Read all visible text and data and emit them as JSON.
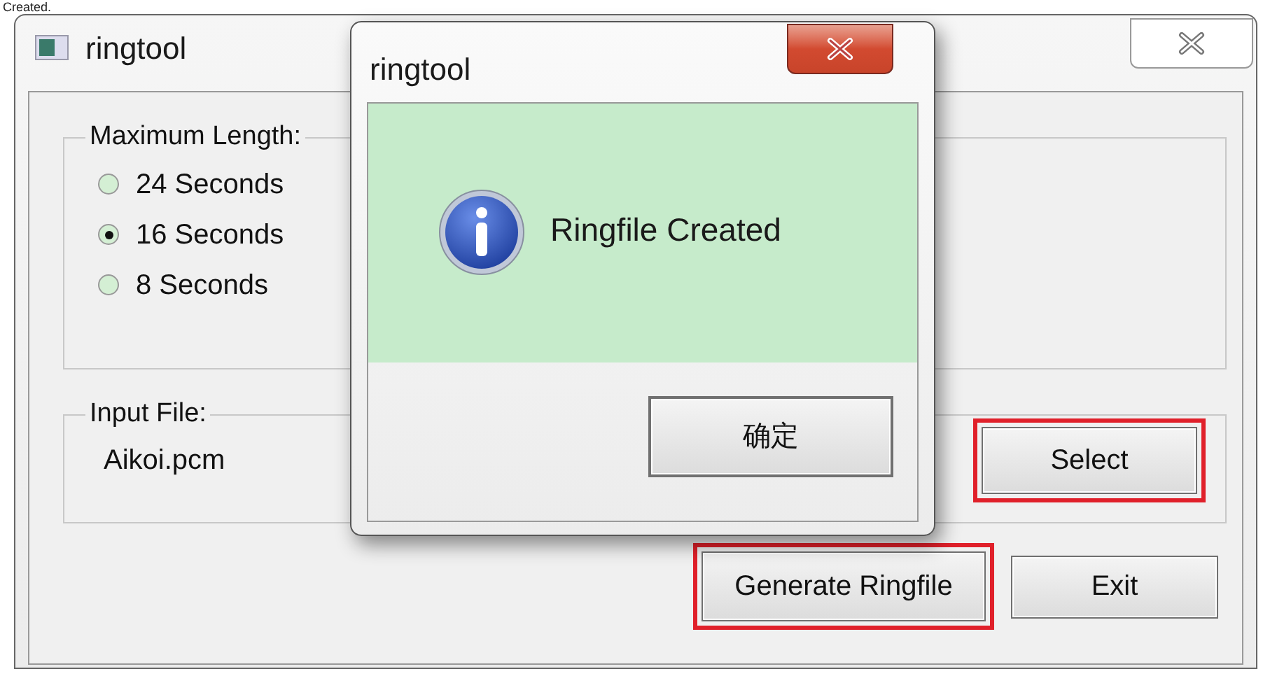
{
  "caption": "Created.",
  "main_window": {
    "title": "ringtool",
    "max_length": {
      "label": "Maximum Length:",
      "options": [
        {
          "label": "24 Seconds",
          "selected": false
        },
        {
          "label": "16 Seconds",
          "selected": true
        },
        {
          "label": "8 Seconds",
          "selected": false
        }
      ]
    },
    "input_file": {
      "label": "Input File:",
      "value": "Aikoi.pcm",
      "button": {
        "label": "Select",
        "highlighted": true
      }
    },
    "buttons": [
      {
        "label": "Generate Ringfile",
        "highlighted": true
      },
      {
        "label": "Exit",
        "highlighted": false
      }
    ]
  },
  "dialog": {
    "title": "ringtool",
    "message": "Ringfile Created",
    "button": "确定"
  }
}
